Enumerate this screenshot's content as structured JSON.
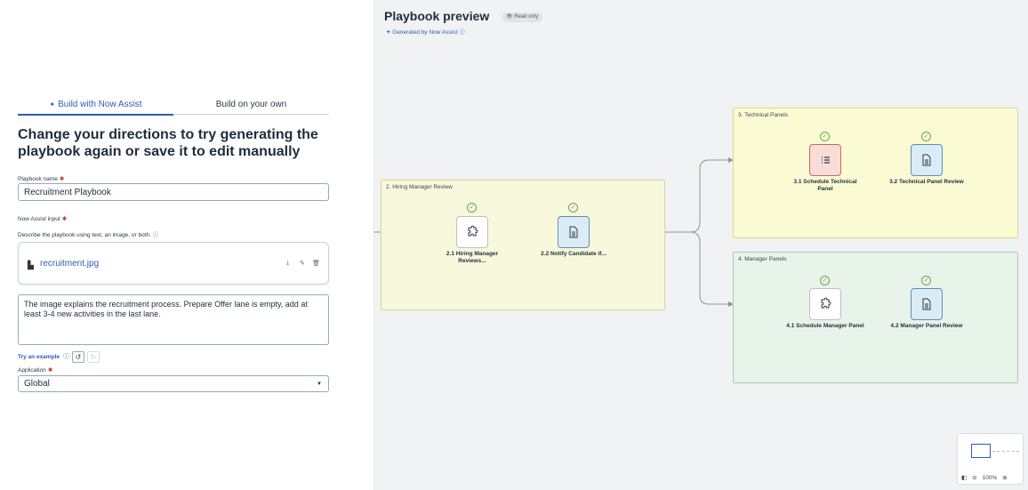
{
  "tabs": [
    {
      "label": "Build with Now Assist",
      "active": true
    },
    {
      "label": "Build on your own",
      "active": false
    }
  ],
  "heading": "Change your directions to try generating the playbook again or save it to edit manually",
  "playbook_name": {
    "label": "Playbook name",
    "value": "Recruitment Playbook"
  },
  "now_assist": {
    "label": "Now Assist input",
    "helper": "Describe the playbook using text, an image, or both.",
    "file_name": "recruitment.jpg",
    "prompt": "The image explains the recruitment process. Prepare Offer lane is empty, add at least 3-4 new activities in the last lane."
  },
  "try_example": "Try an example",
  "application": {
    "label": "Application",
    "value": "Global"
  },
  "preview": {
    "title": "Playbook preview",
    "badge": "Read only",
    "generated_by": "Generated by Now Assist"
  },
  "lanes": [
    {
      "title": "2. Hiring Manager Review",
      "color": "#f7f8dc",
      "nodes": [
        {
          "label": "2.1 Hiring Manager Reviews...",
          "icon": "puzzle-icon"
        },
        {
          "label": "2.2 Notify Candidate if...",
          "icon": "document-icon"
        }
      ]
    },
    {
      "title": "3. Technical Panels",
      "color": "#fbfbd3",
      "nodes": [
        {
          "label": "3.1 Schedule Technical Panel",
          "icon": "list-icon"
        },
        {
          "label": "3.2 Technical Panel Review",
          "icon": "document-icon"
        }
      ]
    },
    {
      "title": "4. Manager Panels",
      "color": "#e8f3ea",
      "nodes": [
        {
          "label": "4.1 Schedule Manager Panel",
          "icon": "puzzle-icon"
        },
        {
          "label": "4.2 Manager Panel Review",
          "icon": "document-icon"
        }
      ]
    }
  ],
  "zoom": "100%"
}
